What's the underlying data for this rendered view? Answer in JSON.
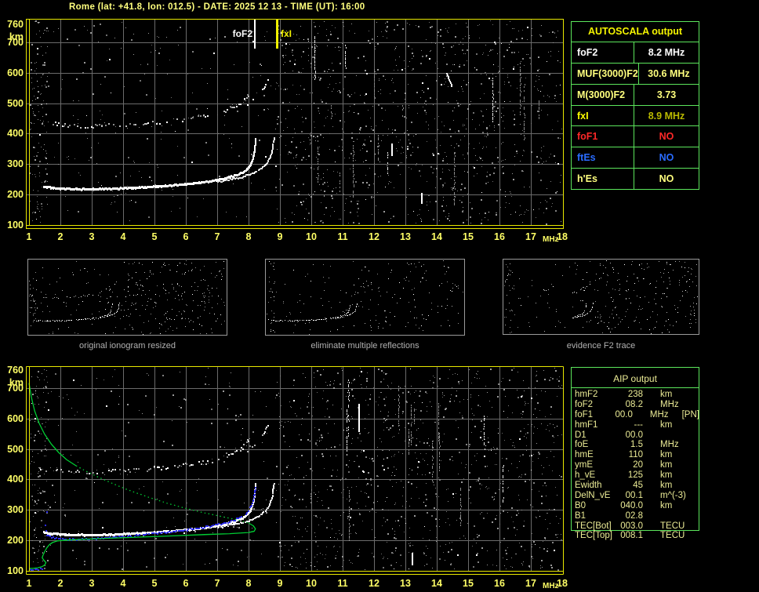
{
  "window": {
    "title": "Rome (lat: +41.8, lon: 012.5) - DATE: 2025 12 13 - TIME (UT): 16:00"
  },
  "colors": {
    "plot_border": "#e8e800",
    "axis_text": "#ffff66",
    "grid": "#6b6b6b",
    "trace_white": "#ffffff",
    "profile_green": "#00cc33",
    "restored_blue": "#2b2be6",
    "table_border": "#5ce65c",
    "autoscala_header": "#f5f500",
    "title_yellow": "#ffff7e",
    "caption_gray": "#b2b2b2",
    "thumb_border": "#9a9a9a",
    "aip_text": "#ecec96"
  },
  "autoscala": {
    "header": "AUTOSCALA output",
    "rows": [
      {
        "label": "foF2",
        "value": "8.2 MHz",
        "color": "#ffffff",
        "value_color": "#ffffff"
      },
      {
        "label": "MUF(3000)F2",
        "value": "30.6 MHz",
        "color": "#ffff7e",
        "value_color": "#ffff7e"
      },
      {
        "label": "M(3000)F2",
        "value": "3.73",
        "color": "#ffff7e",
        "value_color": "#ffff7e"
      },
      {
        "label": "fxI",
        "value": "8.9 MHz",
        "color": "#ffff00",
        "value_color": "#b9b900"
      },
      {
        "label": "foF1",
        "value": "NO",
        "color": "#ff2828",
        "value_color": "#ff2828"
      },
      {
        "label": "ftEs",
        "value": "NO",
        "color": "#2a6cff",
        "value_color": "#2a6cff"
      },
      {
        "label": "h'Es",
        "value": "NO",
        "color": "#ffff7e",
        "value_color": "#ffff7e"
      }
    ]
  },
  "aip": {
    "header": "AIP output",
    "rows": [
      {
        "label": "hmF2",
        "value": "238",
        "unit": "km",
        "note": ""
      },
      {
        "label": "foF2",
        "value": "08.2",
        "unit": "MHz",
        "note": ""
      },
      {
        "label": "foF1",
        "value": "00.0",
        "unit": "MHz",
        "note": "[PN]"
      },
      {
        "label": "hmF1",
        "value": "---",
        "unit": "km",
        "note": ""
      },
      {
        "label": "D1",
        "value": "00.0",
        "unit": "",
        "note": ""
      },
      {
        "label": "foE",
        "value": "1.5",
        "unit": "MHz",
        "note": ""
      },
      {
        "label": "hmE",
        "value": "110",
        "unit": "km",
        "note": ""
      },
      {
        "label": "ymE",
        "value": "20",
        "unit": "km",
        "note": ""
      },
      {
        "label": "h_vE",
        "value": "125",
        "unit": "km",
        "note": ""
      },
      {
        "label": "Ewidth",
        "value": "45",
        "unit": "km",
        "note": ""
      },
      {
        "label": "DelN_vE",
        "value": "00.1",
        "unit": "m^(-3)",
        "note": ""
      },
      {
        "label": "B0",
        "value": "040.0",
        "unit": "km",
        "note": ""
      },
      {
        "label": "B1",
        "value": "02.8",
        "unit": "",
        "note": ""
      },
      {
        "label": "TEC[Bot]",
        "value": "003.0",
        "unit": "TECU",
        "note": ""
      },
      {
        "label": "TEC[Top]",
        "value": "008.1",
        "unit": "TECU",
        "note": ""
      }
    ]
  },
  "thumbnails": [
    {
      "caption": "original ionogram resized",
      "traces": [
        "F2_O",
        "F2_X",
        "hop",
        "hop_x"
      ],
      "tail_only": false,
      "seed": 21,
      "dense": 240,
      "sparse": 70
    },
    {
      "caption": "eliminate multiple reflections",
      "traces": [
        "F2_O",
        "F2_X"
      ],
      "tail_only": false,
      "seed": 22,
      "dense": 130,
      "sparse": 60
    },
    {
      "caption": "evidence F2 trace",
      "traces": [
        "F2_O",
        "F2_X",
        "hop",
        "hop_x"
      ],
      "tail_only": true,
      "seed": 23,
      "dense": 215,
      "sparse": 55
    }
  ],
  "chart_data": [
    {
      "id": "scaled-ionogram",
      "type": "scatter",
      "title": "",
      "xlabel": "MHz",
      "ylabel": "km",
      "xlim": [
        1,
        18
      ],
      "ylim": [
        100,
        760
      ],
      "xticks": [
        1,
        2,
        3,
        4,
        5,
        6,
        7,
        8,
        9,
        10,
        11,
        12,
        13,
        14,
        15,
        16,
        17,
        18
      ],
      "yticks": [
        760,
        700,
        600,
        500,
        400,
        300,
        200,
        100
      ],
      "grid": true,
      "markers": [
        {
          "label": "foF2",
          "mhz": 8.2,
          "color": "#ffffff"
        },
        {
          "label": "fxI",
          "mhz": 8.9,
          "color": "#f0f000"
        }
      ],
      "series": [
        {
          "key": "F2_O",
          "name": "F2-trace-O-mode",
          "color": "#ffffff",
          "points": [
            [
              1.45,
              230
            ],
            [
              1.7,
              225
            ],
            [
              2.0,
              223
            ],
            [
              2.4,
              221
            ],
            [
              2.9,
              221
            ],
            [
              3.4,
              222
            ],
            [
              4.0,
              224
            ],
            [
              4.6,
              227
            ],
            [
              5.2,
              231
            ],
            [
              5.8,
              236
            ],
            [
              6.3,
              241
            ],
            [
              6.8,
              248
            ],
            [
              7.2,
              256
            ],
            [
              7.5,
              264
            ],
            [
              7.8,
              276
            ],
            [
              7.95,
              289
            ],
            [
              8.05,
              303
            ],
            [
              8.12,
              322
            ],
            [
              8.17,
              348
            ],
            [
              8.2,
              375
            ],
            [
              8.21,
              390
            ]
          ]
        },
        {
          "key": "F2_X",
          "name": "F2-trace-X-mode",
          "color": "#ffffff",
          "points": [
            [
              7.0,
              244
            ],
            [
              7.4,
              252
            ],
            [
              7.8,
              261
            ],
            [
              8.1,
              271
            ],
            [
              8.3,
              282
            ],
            [
              8.5,
              297
            ],
            [
              8.62,
              314
            ],
            [
              8.7,
              334
            ],
            [
              8.75,
              356
            ],
            [
              8.78,
              378
            ],
            [
              8.8,
              392
            ]
          ]
        },
        {
          "key": "hop",
          "name": "multiple-reflection-2F",
          "color": "#cccccc",
          "points": [
            [
              1.7,
              438
            ],
            [
              2.0,
              431
            ],
            [
              2.4,
              427
            ],
            [
              2.9,
              426
            ],
            [
              3.4,
              428
            ],
            [
              4.0,
              431
            ],
            [
              4.6,
              435
            ],
            [
              5.2,
              440
            ],
            [
              5.7,
              446
            ],
            [
              6.2,
              452
            ],
            [
              6.6,
              459
            ],
            [
              7.0,
              468
            ],
            [
              7.3,
              479
            ],
            [
              7.6,
              493
            ],
            [
              7.8,
              508
            ],
            [
              7.95,
              526
            ],
            [
              8.05,
              545
            ]
          ]
        },
        {
          "key": "hop_x",
          "name": "multiple-reflection-2F-X",
          "color": "#cccccc",
          "points": [
            [
              7.9,
              490
            ],
            [
              8.1,
              508
            ],
            [
              8.3,
              530
            ],
            [
              8.5,
              558
            ],
            [
              8.62,
              588
            ]
          ]
        }
      ],
      "noise": {
        "seed": 7,
        "dense_from_mhz": 8.85,
        "dense_count": 1060,
        "sparse_count": 235,
        "left_band_count": 130,
        "streaks": 15,
        "white_streaks": [
          [
            14.3,
            558,
            600,
            0.8
          ],
          [
            13.5,
            170,
            206,
            0
          ],
          [
            12.55,
            330,
            368,
            0
          ]
        ]
      }
    },
    {
      "id": "profile-ionogram",
      "type": "scatter",
      "title": "",
      "xlabel": "MHz",
      "ylabel": "km",
      "xlim": [
        1,
        18
      ],
      "ylim": [
        100,
        760
      ],
      "xticks": [
        1,
        2,
        3,
        4,
        5,
        6,
        7,
        8,
        9,
        10,
        11,
        12,
        13,
        14,
        15,
        16,
        17,
        18
      ],
      "yticks": [
        760,
        700,
        600,
        500,
        400,
        300,
        200,
        100
      ],
      "grid": true,
      "markers": [],
      "series_keys": [
        "F2_O",
        "F2_X",
        "hop",
        "hop_x"
      ],
      "restored_trace": {
        "name": "autoscala-restored-trace",
        "color": "#2b2be6",
        "points": [
          [
            1.55,
            218
          ],
          [
            1.8,
            210
          ],
          [
            2.1,
            206
          ],
          [
            2.5,
            205
          ],
          [
            2.9,
            207
          ],
          [
            3.4,
            210
          ],
          [
            3.9,
            214
          ],
          [
            4.4,
            219
          ],
          [
            4.9,
            224
          ],
          [
            5.4,
            229
          ],
          [
            5.9,
            235
          ],
          [
            6.4,
            242
          ],
          [
            6.8,
            250
          ],
          [
            7.2,
            259
          ],
          [
            7.55,
            270
          ],
          [
            7.8,
            283
          ],
          [
            7.97,
            298
          ],
          [
            8.08,
            318
          ],
          [
            8.14,
            342
          ],
          [
            8.18,
            365
          ],
          [
            8.2,
            382
          ]
        ]
      },
      "restored_scatter": [
        [
          1.55,
          296
        ],
        [
          1.5,
          253
        ],
        [
          1.53,
          233
        ]
      ],
      "e_trace": {
        "name": "E-region-trace",
        "color": "#2b2be6",
        "points": [
          [
            1.0,
            107
          ],
          [
            1.1,
            106
          ],
          [
            1.22,
            106
          ],
          [
            1.34,
            108
          ],
          [
            1.44,
            112
          ]
        ]
      },
      "profile": {
        "name": "electron-density-profile",
        "color": "#00cc33",
        "dotted_idx": [
          8,
          19
        ],
        "points": [
          [
            1.0,
            716
          ],
          [
            1.08,
            668
          ],
          [
            1.18,
            625
          ],
          [
            1.32,
            585
          ],
          [
            1.5,
            548
          ],
          [
            1.72,
            515
          ],
          [
            1.95,
            488
          ],
          [
            2.2,
            465
          ],
          [
            2.5,
            445
          ],
          [
            2.8,
            428
          ],
          [
            3.2,
            408
          ],
          [
            3.7,
            385
          ],
          [
            4.2,
            364
          ],
          [
            4.8,
            342
          ],
          [
            5.4,
            322
          ],
          [
            6.0,
            305
          ],
          [
            6.6,
            290
          ],
          [
            7.2,
            277
          ],
          [
            7.7,
            266
          ],
          [
            8.0,
            257
          ],
          [
            8.15,
            248
          ],
          [
            8.22,
            238
          ],
          [
            8.18,
            230
          ],
          [
            8.0,
            226
          ],
          [
            7.4,
            222
          ],
          [
            6.6,
            219
          ],
          [
            5.6,
            215
          ],
          [
            4.6,
            211
          ],
          [
            3.6,
            207
          ],
          [
            2.8,
            204
          ],
          [
            2.2,
            201
          ],
          [
            1.9,
            198
          ],
          [
            1.75,
            193
          ],
          [
            1.65,
            186
          ],
          [
            1.57,
            176
          ],
          [
            1.5,
            163
          ],
          [
            1.45,
            152
          ],
          [
            1.42,
            143
          ],
          [
            1.48,
            134
          ],
          [
            1.54,
            127
          ],
          [
            1.5,
            119
          ],
          [
            1.4,
            113
          ],
          [
            1.28,
            110
          ],
          [
            1.12,
            108
          ],
          [
            1.0,
            108
          ]
        ]
      },
      "noise": {
        "seed": 11,
        "dense_from_mhz": 8.85,
        "dense_count": 1010,
        "sparse_count": 215,
        "left_band_count": 120,
        "streaks": 14,
        "white_streaks": [
          [
            11.5,
            560,
            648,
            0
          ],
          [
            13.2,
            118,
            158,
            0
          ]
        ]
      }
    }
  ]
}
